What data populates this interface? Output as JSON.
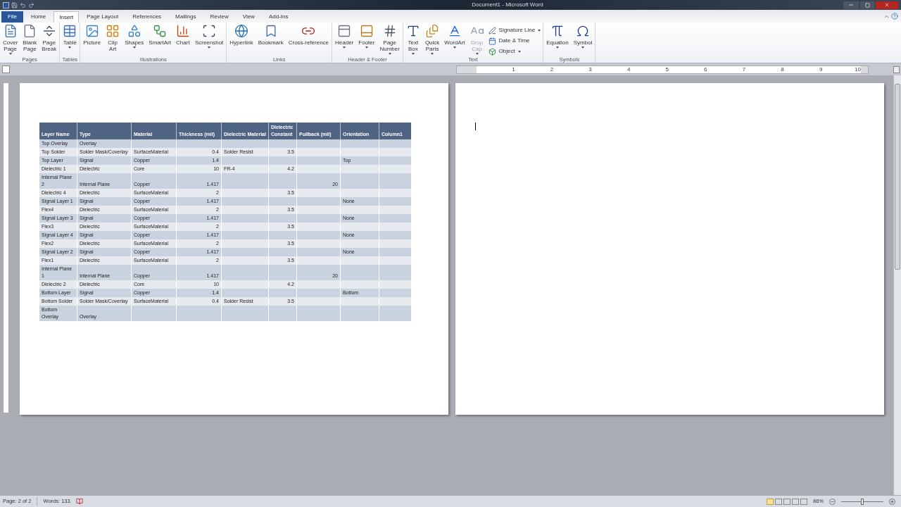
{
  "window": {
    "title": "Document1 - Microsoft Word"
  },
  "tabs": [
    {
      "label": "File",
      "kind": "file",
      "selected": false
    },
    {
      "label": "Home",
      "kind": "tab",
      "selected": false
    },
    {
      "label": "Insert",
      "kind": "tab",
      "selected": true
    },
    {
      "label": "Page Layout",
      "kind": "tab",
      "selected": false
    },
    {
      "label": "References",
      "kind": "tab",
      "selected": false
    },
    {
      "label": "Mailings",
      "kind": "tab",
      "selected": false
    },
    {
      "label": "Review",
      "kind": "tab",
      "selected": false
    },
    {
      "label": "View",
      "kind": "tab",
      "selected": false
    },
    {
      "label": "Add-Ins",
      "kind": "tab",
      "selected": false
    }
  ],
  "ribbon": [
    {
      "label": "Pages",
      "items": [
        {
          "lines": [
            "Cover",
            "Page"
          ],
          "kind": "large",
          "dropdown": true,
          "disabled": false
        },
        {
          "lines": [
            "Blank",
            "Page"
          ],
          "kind": "large",
          "dropdown": false,
          "disabled": false
        },
        {
          "lines": [
            "Page",
            "Break"
          ],
          "kind": "large",
          "dropdown": false,
          "disabled": false
        }
      ]
    },
    {
      "label": "Tables",
      "items": [
        {
          "lines": [
            "Table"
          ],
          "kind": "large",
          "dropdown": true,
          "disabled": false
        }
      ]
    },
    {
      "label": "Illustrations",
      "items": [
        {
          "lines": [
            "Picture"
          ],
          "kind": "large",
          "dropdown": false,
          "disabled": false
        },
        {
          "lines": [
            "Clip",
            "Art"
          ],
          "kind": "large",
          "dropdown": false,
          "disabled": false
        },
        {
          "lines": [
            "Shapes"
          ],
          "kind": "large",
          "dropdown": true,
          "disabled": false
        },
        {
          "lines": [
            "SmartArt"
          ],
          "kind": "large",
          "dropdown": false,
          "disabled": false
        },
        {
          "lines": [
            "Chart"
          ],
          "kind": "large",
          "dropdown": false,
          "disabled": false
        },
        {
          "lines": [
            "Screenshot"
          ],
          "kind": "large",
          "dropdown": true,
          "disabled": false
        }
      ]
    },
    {
      "label": "Links",
      "items": [
        {
          "lines": [
            "Hyperlink"
          ],
          "kind": "large",
          "dropdown": false,
          "disabled": false
        },
        {
          "lines": [
            "Bookmark"
          ],
          "kind": "large",
          "dropdown": false,
          "disabled": false
        },
        {
          "lines": [
            "Cross-reference"
          ],
          "kind": "large",
          "dropdown": false,
          "disabled": false
        }
      ]
    },
    {
      "label": "Header & Footer",
      "items": [
        {
          "lines": [
            "Header"
          ],
          "kind": "large",
          "dropdown": true,
          "disabled": false
        },
        {
          "lines": [
            "Footer"
          ],
          "kind": "large",
          "dropdown": true,
          "disabled": false
        },
        {
          "lines": [
            "Page",
            "Number"
          ],
          "kind": "large",
          "dropdown": true,
          "disabled": false
        }
      ]
    },
    {
      "label": "Text",
      "items": [
        {
          "lines": [
            "Text",
            "Box"
          ],
          "kind": "large",
          "dropdown": true,
          "disabled": false
        },
        {
          "lines": [
            "Quick",
            "Parts"
          ],
          "kind": "large",
          "dropdown": true,
          "disabled": false
        },
        {
          "lines": [
            "WordArt"
          ],
          "kind": "large",
          "dropdown": true,
          "disabled": false
        },
        {
          "lines": [
            "Drop",
            "Cap"
          ],
          "kind": "large",
          "dropdown": true,
          "disabled": true
        },
        {
          "lines": [
            "Signature Line"
          ],
          "kind": "small",
          "dropdown": true,
          "disabled": false
        },
        {
          "lines": [
            "Date & Time"
          ],
          "kind": "small",
          "dropdown": false,
          "disabled": false
        },
        {
          "lines": [
            "Object"
          ],
          "kind": "small",
          "dropdown": true,
          "disabled": false
        }
      ]
    },
    {
      "label": "Symbols",
      "items": [
        {
          "lines": [
            "Equation"
          ],
          "kind": "large",
          "dropdown": true,
          "disabled": false
        },
        {
          "lines": [
            "Symbol"
          ],
          "kind": "large",
          "dropdown": true,
          "disabled": false
        }
      ]
    }
  ],
  "ruler": {
    "numbers": [
      "1",
      "2",
      "3",
      "4",
      "5",
      "6",
      "7",
      "8",
      "9",
      "10"
    ]
  },
  "table": {
    "columns": [
      "Layer Name",
      "Type",
      "Material",
      "Thickness (mil)",
      "Dielectric Material",
      "Dielectric Constant",
      "Pullback (mil)",
      "Orientation",
      "Column1"
    ],
    "rows": [
      [
        "Top Overlay",
        "Overlay",
        "",
        "",
        "",
        "",
        "",
        "",
        ""
      ],
      [
        "Top Solder",
        "Solder Mask/Coverlay",
        "SurfaceMaterial",
        "0.4",
        "Solder Resist",
        "3.5",
        "",
        "",
        ""
      ],
      [
        "Top Layer",
        "Signal",
        "Copper",
        "1.4",
        "",
        "",
        "",
        "Top",
        ""
      ],
      [
        "Dielectric 1",
        "Dielectric",
        "Core",
        "10",
        "FR-4",
        "4.2",
        "",
        "",
        ""
      ],
      [
        "Internal Plane 2",
        "Internal Plane",
        "Copper",
        "1.417",
        "",
        "",
        "20",
        "",
        ""
      ],
      [
        "Dielectric 4",
        "Dielectric",
        "SurfaceMaterial",
        "2",
        "",
        "3.5",
        "",
        "",
        ""
      ],
      [
        "Signal Layer 1",
        "Signal",
        "Copper",
        "1.417",
        "",
        "",
        "",
        "None",
        ""
      ],
      [
        "Flex4",
        "Dielectric",
        "SurfaceMaterial",
        "2",
        "",
        "3.5",
        "",
        "",
        ""
      ],
      [
        "Signal Layer 3",
        "Signal",
        "Copper",
        "1.417",
        "",
        "",
        "",
        "None",
        ""
      ],
      [
        "Flex3",
        "Dielectric",
        "SurfaceMaterial",
        "2",
        "",
        "3.5",
        "",
        "",
        ""
      ],
      [
        "Signal Layer 4",
        "Signal",
        "Copper",
        "1.417",
        "",
        "",
        "",
        "None",
        ""
      ],
      [
        "Flex2",
        "Dielectric",
        "SurfaceMaterial",
        "2",
        "",
        "3.5",
        "",
        "",
        ""
      ],
      [
        "Signal Layer 2",
        "Signal",
        "Copper",
        "1.417",
        "",
        "",
        "",
        "None",
        ""
      ],
      [
        "Flex1",
        "Dielectric",
        "SurfaceMaterial",
        "2",
        "",
        "3.5",
        "",
        "",
        ""
      ],
      [
        "Internal Plane 1",
        "Internal Plane",
        "Copper",
        "1.417",
        "",
        "",
        "20",
        "",
        ""
      ],
      [
        "Dielectric 2",
        "Dielectric",
        "Core",
        "10",
        "",
        "4.2",
        "",
        "",
        ""
      ],
      [
        "Bottom Layer",
        "Signal",
        "Copper",
        "1.4",
        "",
        "",
        "",
        "Bottom",
        ""
      ],
      [
        "Bottom Solder",
        "Solder Mask/Coverlay",
        "SurfaceMaterial",
        "0.4",
        "Solder Resist",
        "3.5",
        "",
        "",
        ""
      ],
      [
        "Bottom Overlay",
        "Overlay",
        "",
        "",
        "",
        "",
        "",
        "",
        ""
      ]
    ]
  },
  "status_bar": {
    "page": "Page: 2 of 2",
    "words": "Words: 133",
    "zoom": "86%",
    "zoom_level": {
      "level": 0.5
    }
  }
}
